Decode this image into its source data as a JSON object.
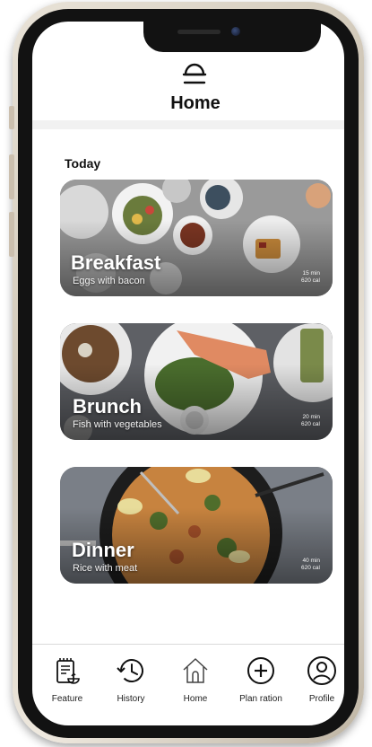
{
  "header": {
    "title": "Home",
    "icon": "meal-cloche-icon"
  },
  "section": {
    "label": "Today"
  },
  "meals": [
    {
      "title": "Breakfast",
      "subtitle": "Eggs with bacon",
      "time": "15 min",
      "calories": "620 cal"
    },
    {
      "title": "Brunch",
      "subtitle": "Fish with vegetables",
      "time": "20 min",
      "calories": "620 cal"
    },
    {
      "title": "Dinner",
      "subtitle": "Rice with meat",
      "time": "40 min",
      "calories": "620 cal"
    }
  ],
  "nav": {
    "items": [
      {
        "label": "Feature",
        "icon": "recipe-clipboard-icon"
      },
      {
        "label": "History",
        "icon": "history-clock-icon"
      },
      {
        "label": "Home",
        "icon": "home-icon"
      },
      {
        "label": "Plan ration",
        "icon": "plus-circle-icon"
      },
      {
        "label": "Profile",
        "icon": "profile-avatar-icon"
      }
    ]
  },
  "colors": {
    "text": "#111111",
    "frame": "#121212",
    "card_overlay": "#000000"
  }
}
